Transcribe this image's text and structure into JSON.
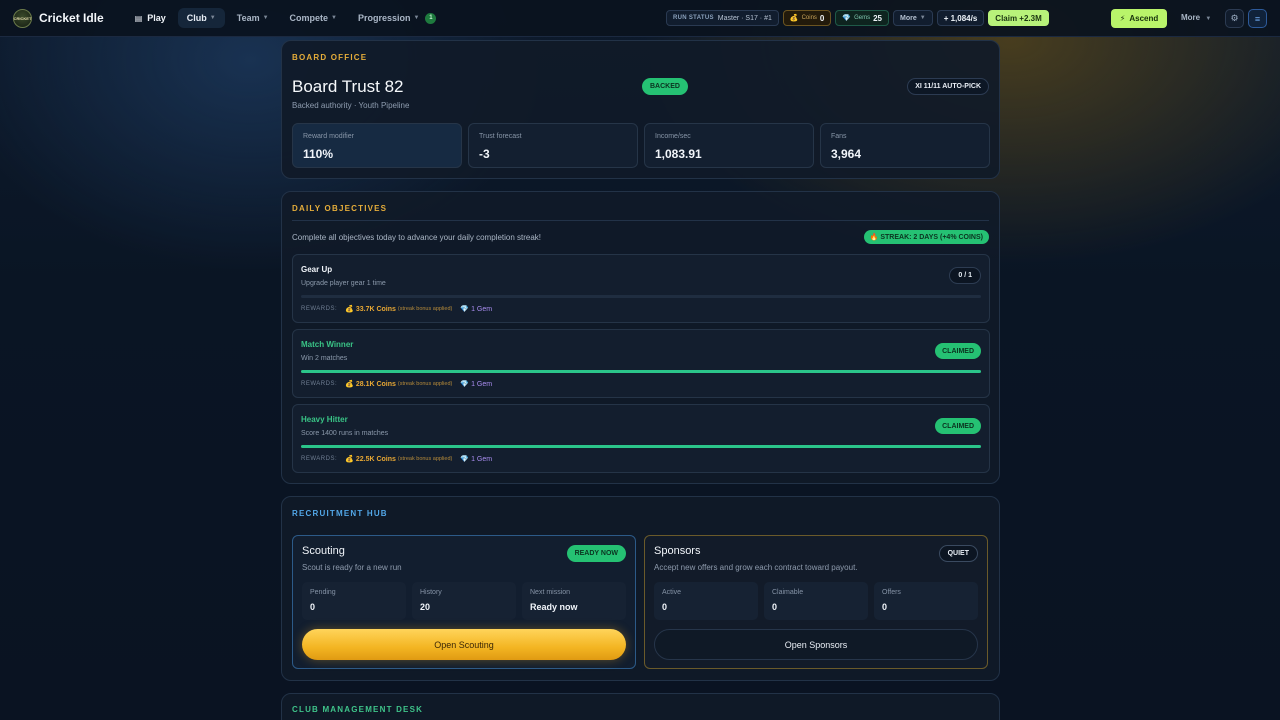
{
  "app": {
    "logo_text": "CRICKET",
    "name": "Cricket Idle"
  },
  "nav": {
    "play": "Play",
    "club": "Club",
    "team": "Team",
    "compete": "Compete",
    "progression": "Progression",
    "progression_badge": "1"
  },
  "status": {
    "run_label": "RUN STATUS",
    "run_value": "Master · S17 · #1",
    "coins_label": "Coins",
    "coins_value": "0",
    "gems_label": "Gems",
    "gems_value": "25",
    "more": "More",
    "rate": "+ 1,084/s",
    "claim": "Claim +2.3M"
  },
  "actions": {
    "ascend": "Ascend",
    "more": "More"
  },
  "board": {
    "section": "BOARD OFFICE",
    "title": "Board Trust 82",
    "subtitle": "Backed authority · Youth Pipeline",
    "badge": "BACKED",
    "xi_badge": "XI 11/11 AUTO-PICK",
    "stats": [
      {
        "label": "Reward modifier",
        "value": "110%"
      },
      {
        "label": "Trust forecast",
        "value": "-3"
      },
      {
        "label": "Income/sec",
        "value": "1,083.91"
      },
      {
        "label": "Fans",
        "value": "3,964"
      }
    ]
  },
  "objectives": {
    "section": "DAILY OBJECTIVES",
    "intro": "Complete all objectives today to advance your daily completion streak!",
    "streak": "🔥 STREAK: 2 DAYS (+4% COINS)",
    "rewards_label": "REWARDS:",
    "streak_note": "(streak bonus applied)",
    "items": [
      {
        "title": "Gear Up",
        "desc": "Upgrade player gear 1 time",
        "status": "0 / 1",
        "progress": 0,
        "coins": "33.7K Coins",
        "gems": "1 Gem"
      },
      {
        "title": "Match Winner",
        "desc": "Win 2 matches",
        "status": "CLAIMED",
        "progress": 1,
        "coins": "28.1K Coins",
        "gems": "1 Gem"
      },
      {
        "title": "Heavy Hitter",
        "desc": "Score 1400 runs in matches",
        "status": "CLAIMED",
        "progress": 1,
        "coins": "22.5K Coins",
        "gems": "1 Gem"
      }
    ]
  },
  "recruitment": {
    "section": "RECRUITMENT HUB",
    "scouting": {
      "title": "Scouting",
      "subtitle": "Scout is ready for a new run",
      "badge": "READY NOW",
      "stats": [
        {
          "label": "Pending",
          "value": "0"
        },
        {
          "label": "History",
          "value": "20"
        },
        {
          "label": "Next mission",
          "value": "Ready now"
        }
      ],
      "button": "Open Scouting"
    },
    "sponsors": {
      "title": "Sponsors",
      "subtitle": "Accept new offers and grow each contract toward payout.",
      "badge": "QUIET",
      "stats": [
        {
          "label": "Active",
          "value": "0"
        },
        {
          "label": "Claimable",
          "value": "0"
        },
        {
          "label": "Offers",
          "value": "0"
        }
      ],
      "button": "Open Sponsors"
    }
  },
  "management": {
    "section": "CLUB MANAGEMENT DESK"
  }
}
